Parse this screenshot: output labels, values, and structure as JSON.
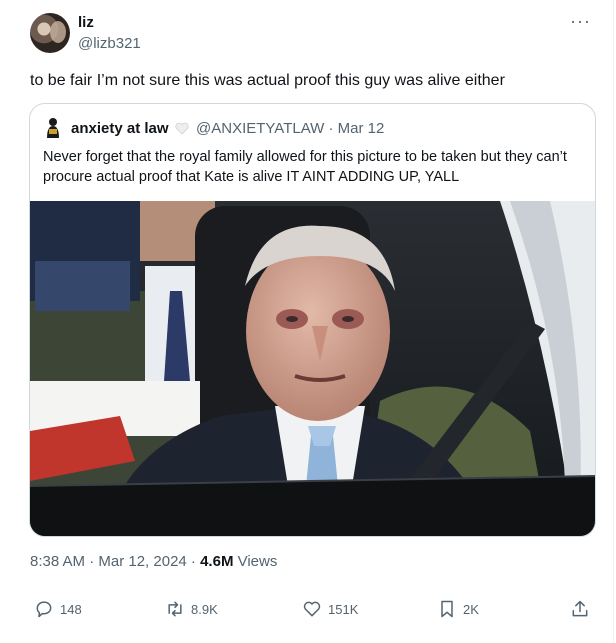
{
  "tweet": {
    "author_name": "liz",
    "author_handle": "@lizb321",
    "more_label": "···",
    "text": "to be fair I’m not sure this was actual proof this guy was alive either"
  },
  "quoted": {
    "author_name": "anxiety at law",
    "author_handle": "@ANXIETYATLAW · Mar 12",
    "text": "Never forget that the royal family allowed for this picture to be taken but they can’t procure actual proof that Kate is alive IT AINT ADDING UP, YALL"
  },
  "meta": {
    "timestamp": "8:38 AM · Mar 12, 2024 · ",
    "views_count": "4.6M",
    "views_label": " Views"
  },
  "actions": {
    "replies": "148",
    "reposts": "8.9K",
    "likes": "151K",
    "bookmarks": "2K"
  },
  "colors": {
    "text_primary": "#0f1419",
    "text_secondary": "#536471",
    "border": "#cfd9de"
  },
  "icons": [
    "reply-icon",
    "repost-icon",
    "like-icon",
    "bookmark-icon",
    "share-icon",
    "white-heart-icon"
  ]
}
